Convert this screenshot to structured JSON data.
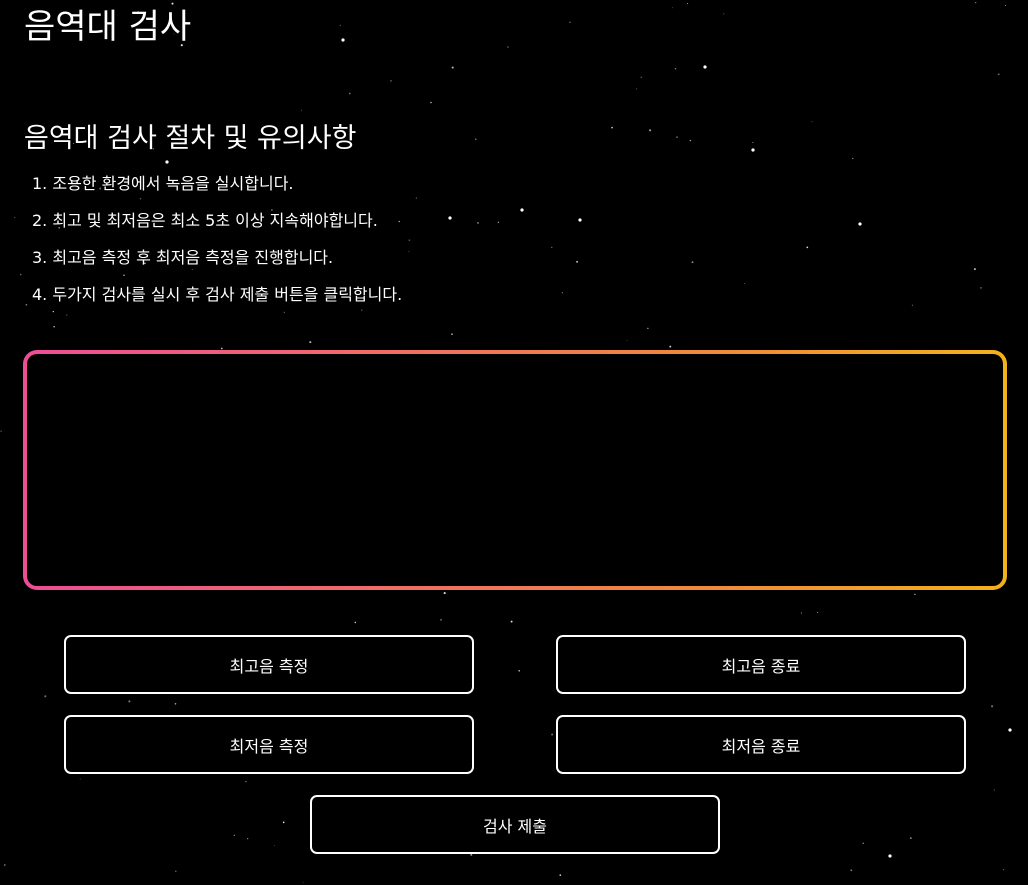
{
  "header": {
    "title": "음역대 검사"
  },
  "instructions": {
    "title": "음역대 검사 절차 및 유의사항",
    "steps": [
      "1. 조용한 환경에서 녹음을 실시합니다.",
      "2. 최고 및 최저음은 최소 5초 이상 지속해야합니다.",
      "3. 최고음 측정 후 최저음 측정을 진행합니다.",
      "4. 두가지 검사를 실시 후 검사 제출 버튼을 클릭합니다."
    ]
  },
  "visualizer": {
    "gradient_start": "#ee4d97",
    "gradient_end": "#f2b21a"
  },
  "controls": {
    "high_start_label": "최고음 측정",
    "high_stop_label": "최고음 종료",
    "low_start_label": "최저음 측정",
    "low_stop_label": "최저음 종료",
    "submit_label": "검사 제출"
  },
  "theme": {
    "background": "#000000",
    "text": "#ffffff",
    "button_border": "#ffffff"
  }
}
